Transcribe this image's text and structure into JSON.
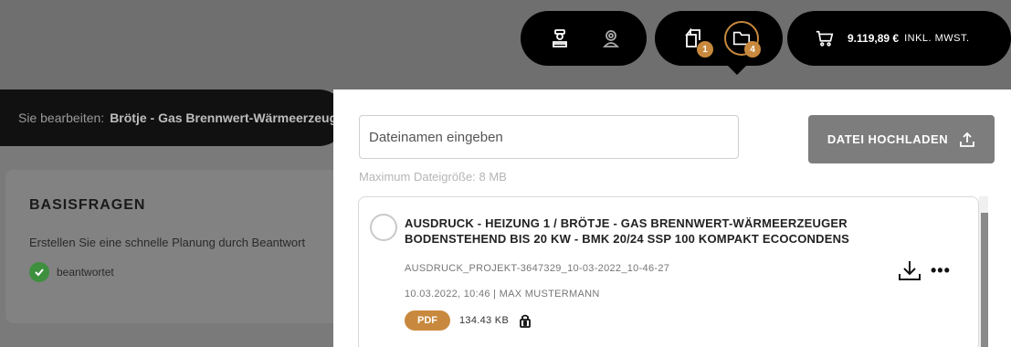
{
  "background": {
    "edit_prefix": "Sie bearbeiten:",
    "edit_title": "Brötje - Gas Brennwert-Wärmeerzeug",
    "card_title": "BASISFRAGEN",
    "card_text": "Erstellen Sie eine schnelle Planung durch Beantwort",
    "answered_label": "beantwortet"
  },
  "header": {
    "docs_badge": "1",
    "files_badge": "4",
    "cart_total": "9.119,89 €",
    "cart_tax": "INKL. MWST."
  },
  "panel": {
    "search_placeholder": "Dateinamen eingeben",
    "upload_label": "DATEI HOCHLADEN",
    "max_size_hint": "Maximum Dateigröße: 8 MB",
    "file": {
      "title": "AUSDRUCK - HEIZUNG 1 / BRÖTJE - GAS BRENNWERT-WÄRMEERZEUGER BODENSTEHEND BIS 20 KW - BMK 20/24 SSP 100 KOMPAKT ECOCONDENS",
      "filename": "AUSDRUCK_PROJEKT-3647329_10-03-2022_10-46-27",
      "meta": "10.03.2022, 10:46 | MAX MUSTERMANN",
      "type": "PDF",
      "size": "134.43 KB"
    }
  },
  "colors": {
    "accent": "#c8893e",
    "check": "#3e8f3e"
  }
}
